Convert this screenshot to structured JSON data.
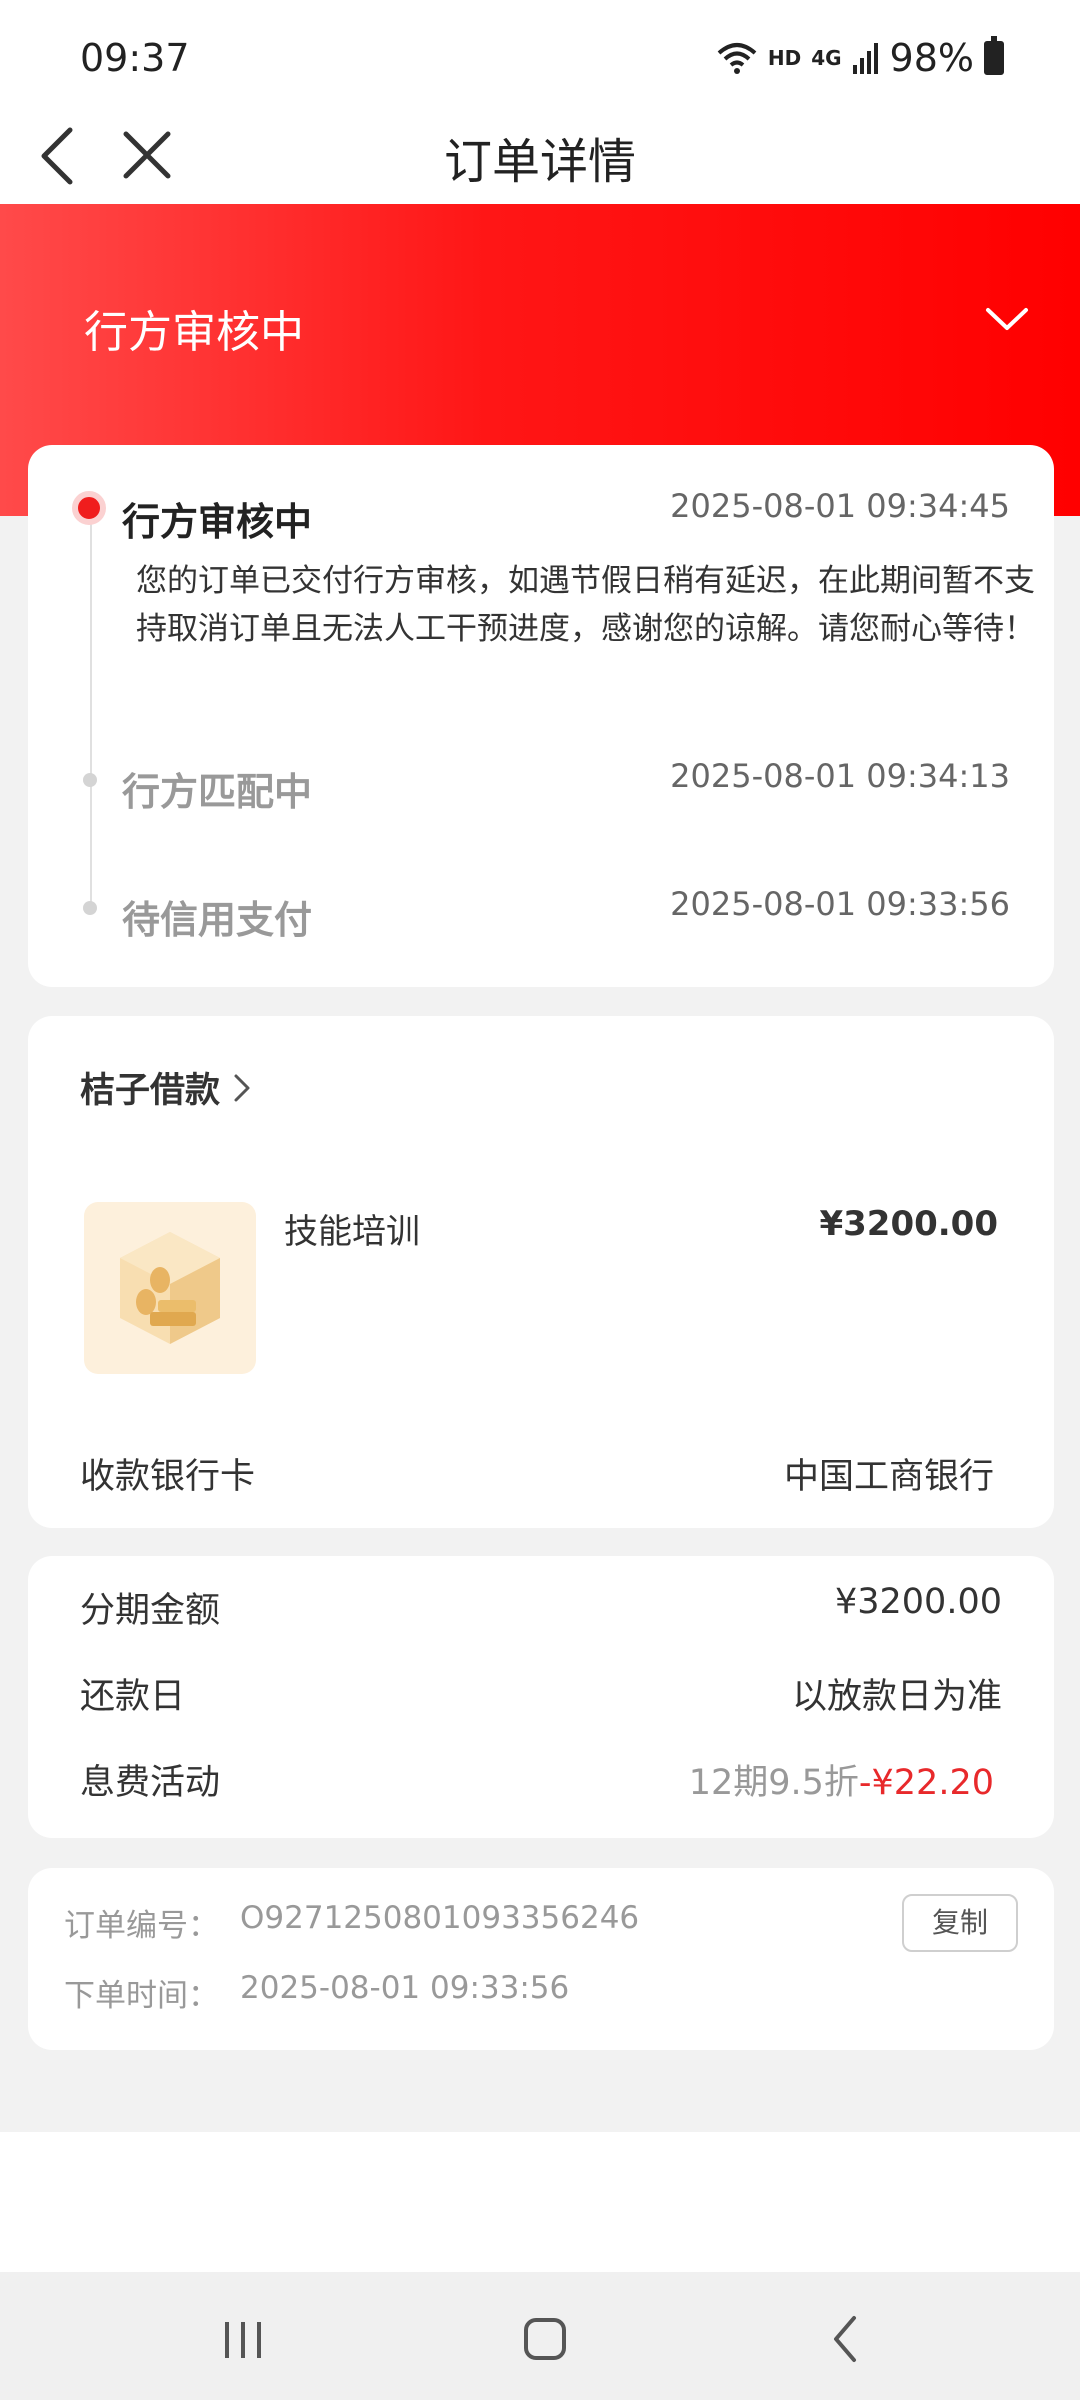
{
  "status_bar": {
    "time": "09:37",
    "network": "HD",
    "signal": "4G",
    "battery": "98%"
  },
  "nav": {
    "title": "订单详情"
  },
  "header": {
    "status": "行方审核中"
  },
  "timeline": [
    {
      "title": "行方审核中",
      "time": "2025-08-01 09:34:45",
      "description": "您的订单已交付行方审核，如遇节假日稍有延迟，在此期间暂不支持取消订单且无法人工干预进度，感谢您的谅解。请您耐心等待！"
    },
    {
      "title": "行方匹配中",
      "time": "2025-08-01 09:34:13"
    },
    {
      "title": "待信用支付",
      "time": "2025-08-01 09:33:56"
    }
  ],
  "merchant": {
    "name": "桔子借款",
    "product_name": "技能培训",
    "product_price": "¥3200.00",
    "bank_label": "收款银行卡",
    "bank_value": "中国工商银行"
  },
  "installment": {
    "amount_label": "分期金额",
    "amount_value": "¥3200.00",
    "repay_label": "还款日",
    "repay_value": "以放款日为准",
    "promo_label": "息费活动",
    "promo_desc": "12期9.5折",
    "promo_discount": "-¥22.20"
  },
  "order": {
    "no_label": "订单编号：",
    "no_value": "O9271250801093356246",
    "time_label": "下单时间：",
    "time_value": "2025-08-01 09:33:56",
    "copy_label": "复制"
  },
  "colors": {
    "accent": "#ff1a1a",
    "discount": "#e8292b"
  }
}
